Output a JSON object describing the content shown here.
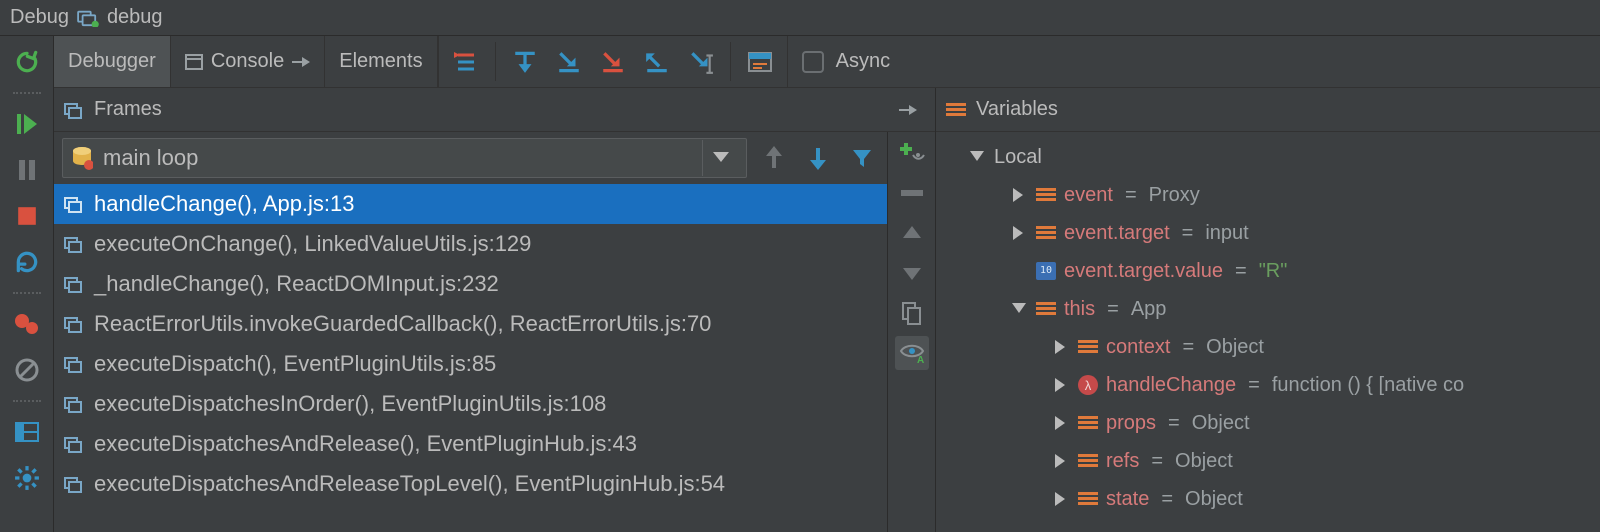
{
  "window": {
    "tool_name": "Debug",
    "config_name": "debug"
  },
  "tabs": {
    "debugger": "Debugger",
    "console": "Console",
    "elements": "Elements"
  },
  "toolbar": {
    "async_label": "Async"
  },
  "frames": {
    "title": "Frames",
    "thread": "main loop",
    "stack": [
      {
        "label": "handleChange(), App.js:13",
        "selected": true
      },
      {
        "label": "executeOnChange(), LinkedValueUtils.js:129"
      },
      {
        "label": "_handleChange(), ReactDOMInput.js:232"
      },
      {
        "label": "ReactErrorUtils.invokeGuardedCallback(), ReactErrorUtils.js:70"
      },
      {
        "label": "executeDispatch(), EventPluginUtils.js:85"
      },
      {
        "label": "executeDispatchesInOrder(), EventPluginUtils.js:108"
      },
      {
        "label": "executeDispatchesAndRelease(), EventPluginHub.js:43"
      },
      {
        "label": "executeDispatchesAndReleaseTopLevel(), EventPluginHub.js:54"
      }
    ]
  },
  "variables": {
    "title": "Variables",
    "scope": "Local",
    "items": [
      {
        "kind": "obj",
        "depth": 2,
        "arrow": "right",
        "name": "event",
        "eq": " = ",
        "value": "Proxy"
      },
      {
        "kind": "obj",
        "depth": 2,
        "arrow": "right",
        "name": "event.target",
        "eq": " = ",
        "value": "input"
      },
      {
        "kind": "prim",
        "depth": 2,
        "arrow": "none",
        "name": "event.target.value",
        "eq": " = ",
        "value": "\"R\"",
        "string": true
      },
      {
        "kind": "obj",
        "depth": 2,
        "arrow": "down",
        "name": "this",
        "eq": " = ",
        "value": "App"
      },
      {
        "kind": "obj",
        "depth": 3,
        "arrow": "right",
        "name": "context",
        "eq": " = ",
        "value": "Object"
      },
      {
        "kind": "fn",
        "depth": 3,
        "arrow": "right",
        "name": "handleChange",
        "eq": " = ",
        "value": "function () { [native co"
      },
      {
        "kind": "obj",
        "depth": 3,
        "arrow": "right",
        "name": "props",
        "eq": " = ",
        "value": "Object"
      },
      {
        "kind": "obj",
        "depth": 3,
        "arrow": "right",
        "name": "refs",
        "eq": " = ",
        "value": "Object"
      },
      {
        "kind": "obj",
        "depth": 3,
        "arrow": "right",
        "name": "state",
        "eq": " = ",
        "value": "Object"
      }
    ]
  }
}
